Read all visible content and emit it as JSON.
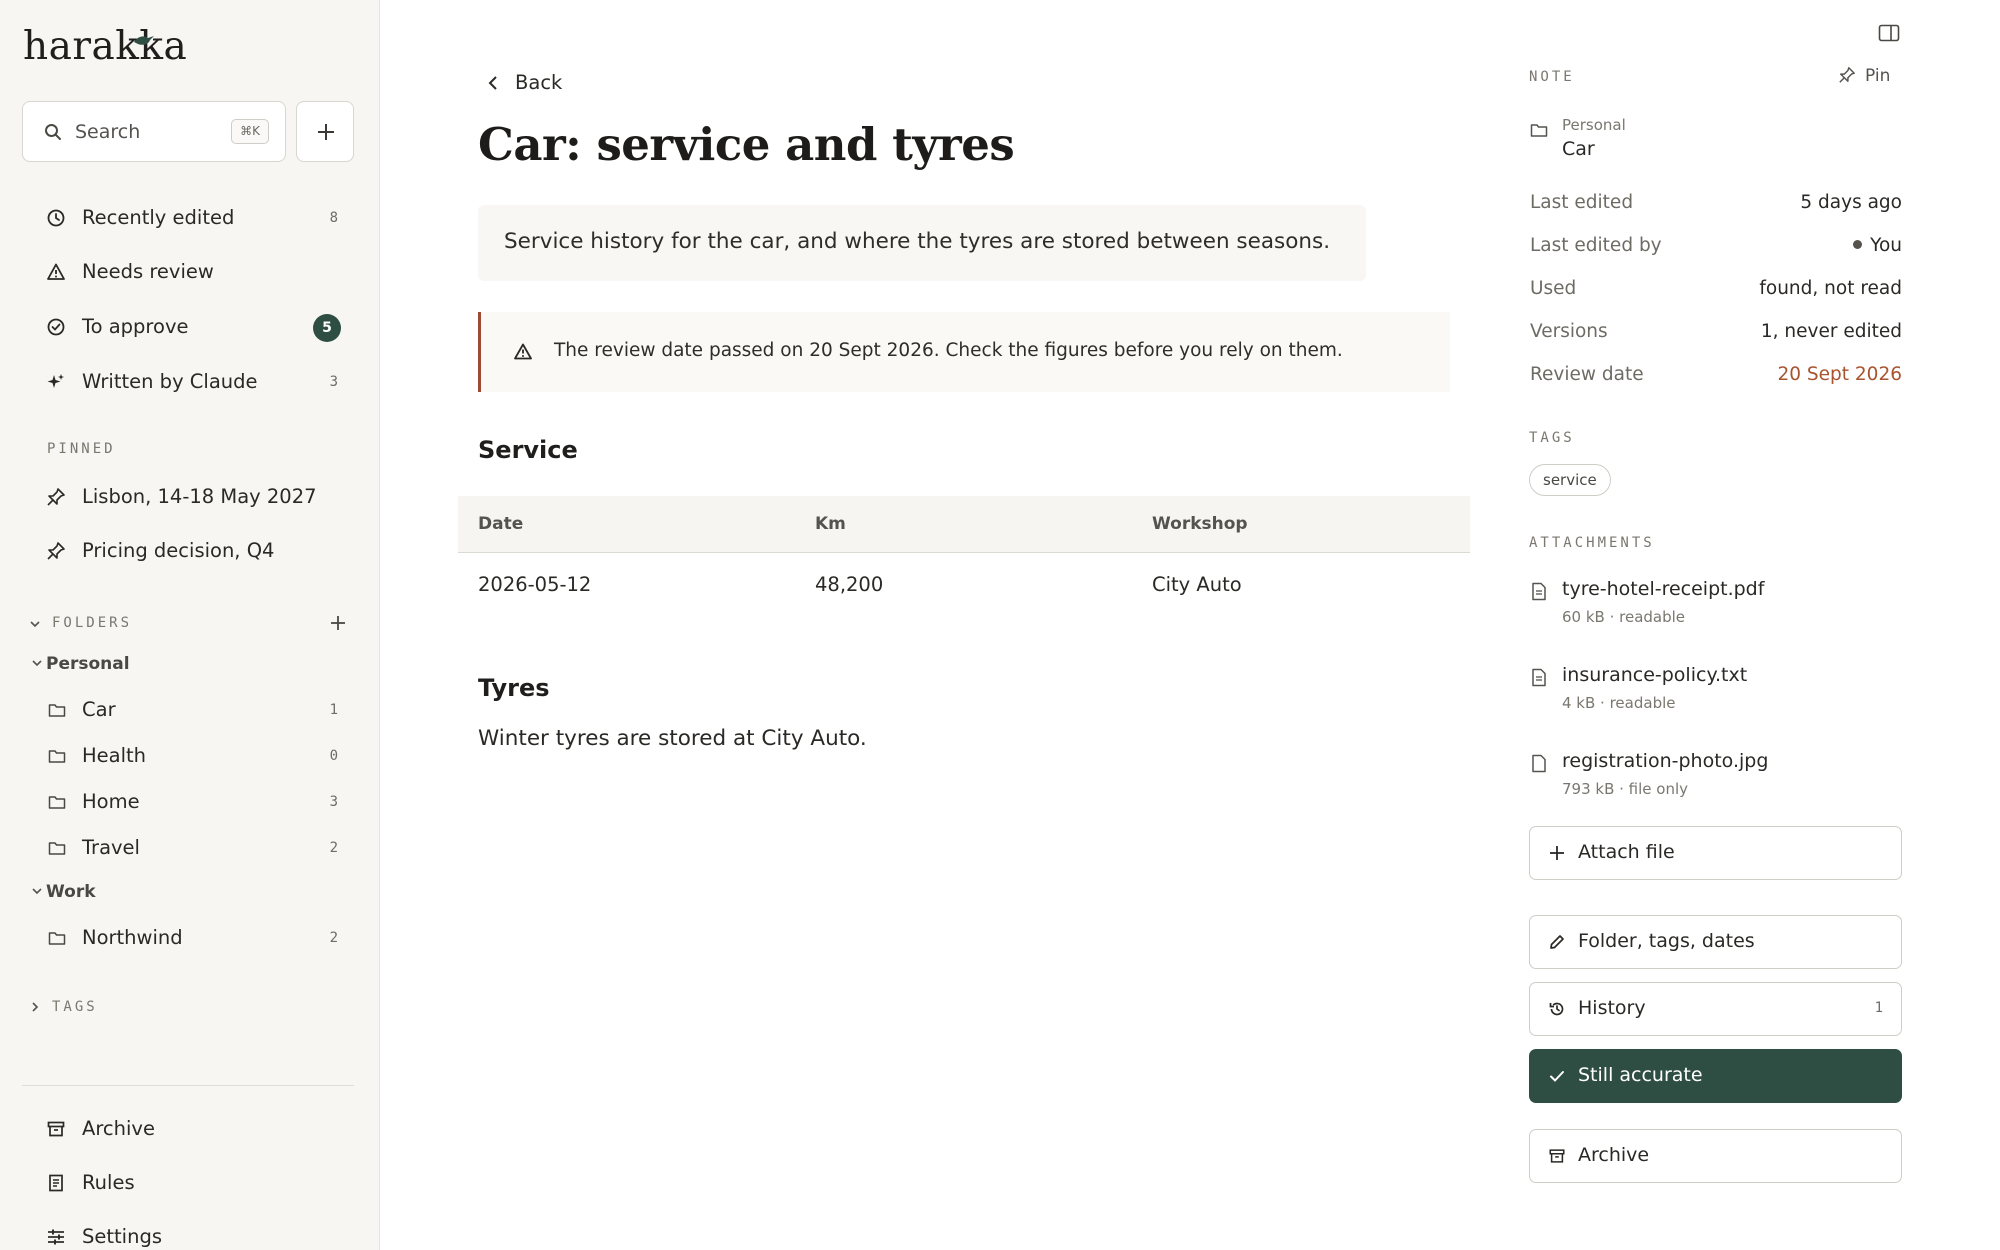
{
  "app": {
    "logo": "harakka"
  },
  "sidebar": {
    "search": {
      "label": "Search",
      "shortcut": "⌘K"
    },
    "nav": [
      {
        "label": "Recently edited",
        "count": "8",
        "icon": "clock-icon"
      },
      {
        "label": "Needs review",
        "count": "",
        "icon": "warning-icon"
      },
      {
        "label": "To approve",
        "count": "5",
        "icon": "check-circle-icon"
      },
      {
        "label": "Written by Claude",
        "count": "3",
        "icon": "sparkle-icon"
      }
    ],
    "pinned_label": "PINNED",
    "pinned": [
      {
        "label": "Lisbon, 14-18 May 2027"
      },
      {
        "label": "Pricing decision, Q4"
      }
    ],
    "folders_label": "FOLDERS",
    "groups": [
      {
        "label": "Personal"
      },
      {
        "label": "Work"
      }
    ],
    "folders": [
      {
        "label": "Car",
        "count": "1"
      },
      {
        "label": "Health",
        "count": "0"
      },
      {
        "label": "Home",
        "count": "3"
      },
      {
        "label": "Travel",
        "count": "2"
      },
      {
        "label": "Northwind",
        "count": "2"
      }
    ],
    "tags_label": "TAGS",
    "bottom": [
      {
        "label": "Archive"
      },
      {
        "label": "Rules"
      },
      {
        "label": "Settings"
      }
    ]
  },
  "main": {
    "back_label": "Back",
    "title": "Car: service and tyres",
    "summary": "Service history for the car, and where the tyres are stored between seasons.",
    "warning": "The review date passed on 20 Sept 2026. Check the figures before you rely on them.",
    "service_heading": "Service",
    "table": {
      "columns": [
        "Date",
        "Km",
        "Workshop"
      ],
      "rows": [
        [
          "2026-05-12",
          "48,200",
          "City Auto"
        ]
      ]
    },
    "tyres_heading": "Tyres",
    "tyres_text": "Winter tyres are stored at City Auto."
  },
  "panel": {
    "note_label": "NOTE",
    "pin_label": "Pin",
    "folder_parent": "Personal",
    "folder_name": "Car",
    "meta": [
      {
        "key": "Last edited",
        "value": "5 days ago"
      },
      {
        "key": "Last edited by",
        "value": "You"
      },
      {
        "key": "Used",
        "value": "found, not read"
      },
      {
        "key": "Versions",
        "value": "1, never edited"
      },
      {
        "key": "Review date",
        "value": "20 Sept 2026"
      }
    ],
    "tags_label": "TAGS",
    "tags": [
      "service"
    ],
    "attachments_label": "ATTACHMENTS",
    "attachments": [
      {
        "name": "tyre-hotel-receipt.pdf",
        "info": "60 kB · readable"
      },
      {
        "name": "insurance-policy.txt",
        "info": "4 kB · readable"
      },
      {
        "name": "registration-photo.jpg",
        "info": "793 kB · file only"
      }
    ],
    "attach_label": "Attach file",
    "edit_meta_label": "Folder, tags, dates",
    "history_label": "History",
    "history_count": "1",
    "accurate_label": "Still accurate",
    "archive_label": "Archive"
  },
  "colors": {
    "accent": "#2f4e43",
    "warning": "#9c4a36",
    "review_date": "#a8542f"
  }
}
